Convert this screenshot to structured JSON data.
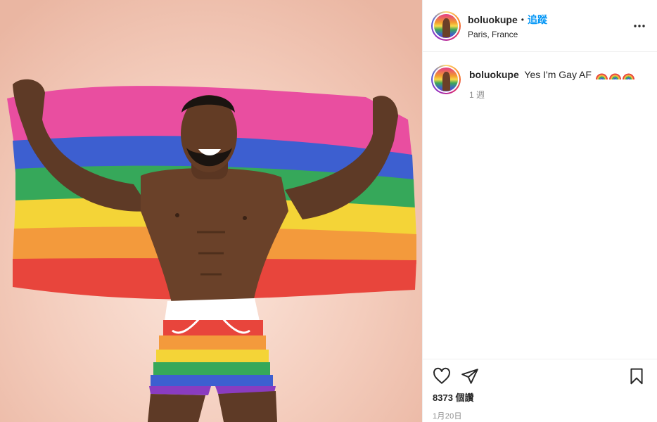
{
  "post": {
    "username": "boluokupe",
    "separator": "•",
    "follow_label": "追蹤",
    "location": "Paris, France",
    "more_icon": "more-options-icon",
    "photo_description_icon": "rainbow-flag-photo"
  },
  "caption": {
    "username": "boluokupe",
    "text": "Yes I'm Gay AF",
    "emojis": [
      "rainbow",
      "rainbow",
      "rainbow"
    ],
    "time": "1 週"
  },
  "actions": {
    "like_icon": "heart-icon",
    "share_icon": "paper-plane-icon",
    "save_icon": "bookmark-icon",
    "views": "8373 個讚",
    "date": "1月20日"
  },
  "colors": {
    "link": "#0095f6",
    "muted": "#8e8e8e",
    "text": "#262626",
    "border": "#efefef"
  }
}
